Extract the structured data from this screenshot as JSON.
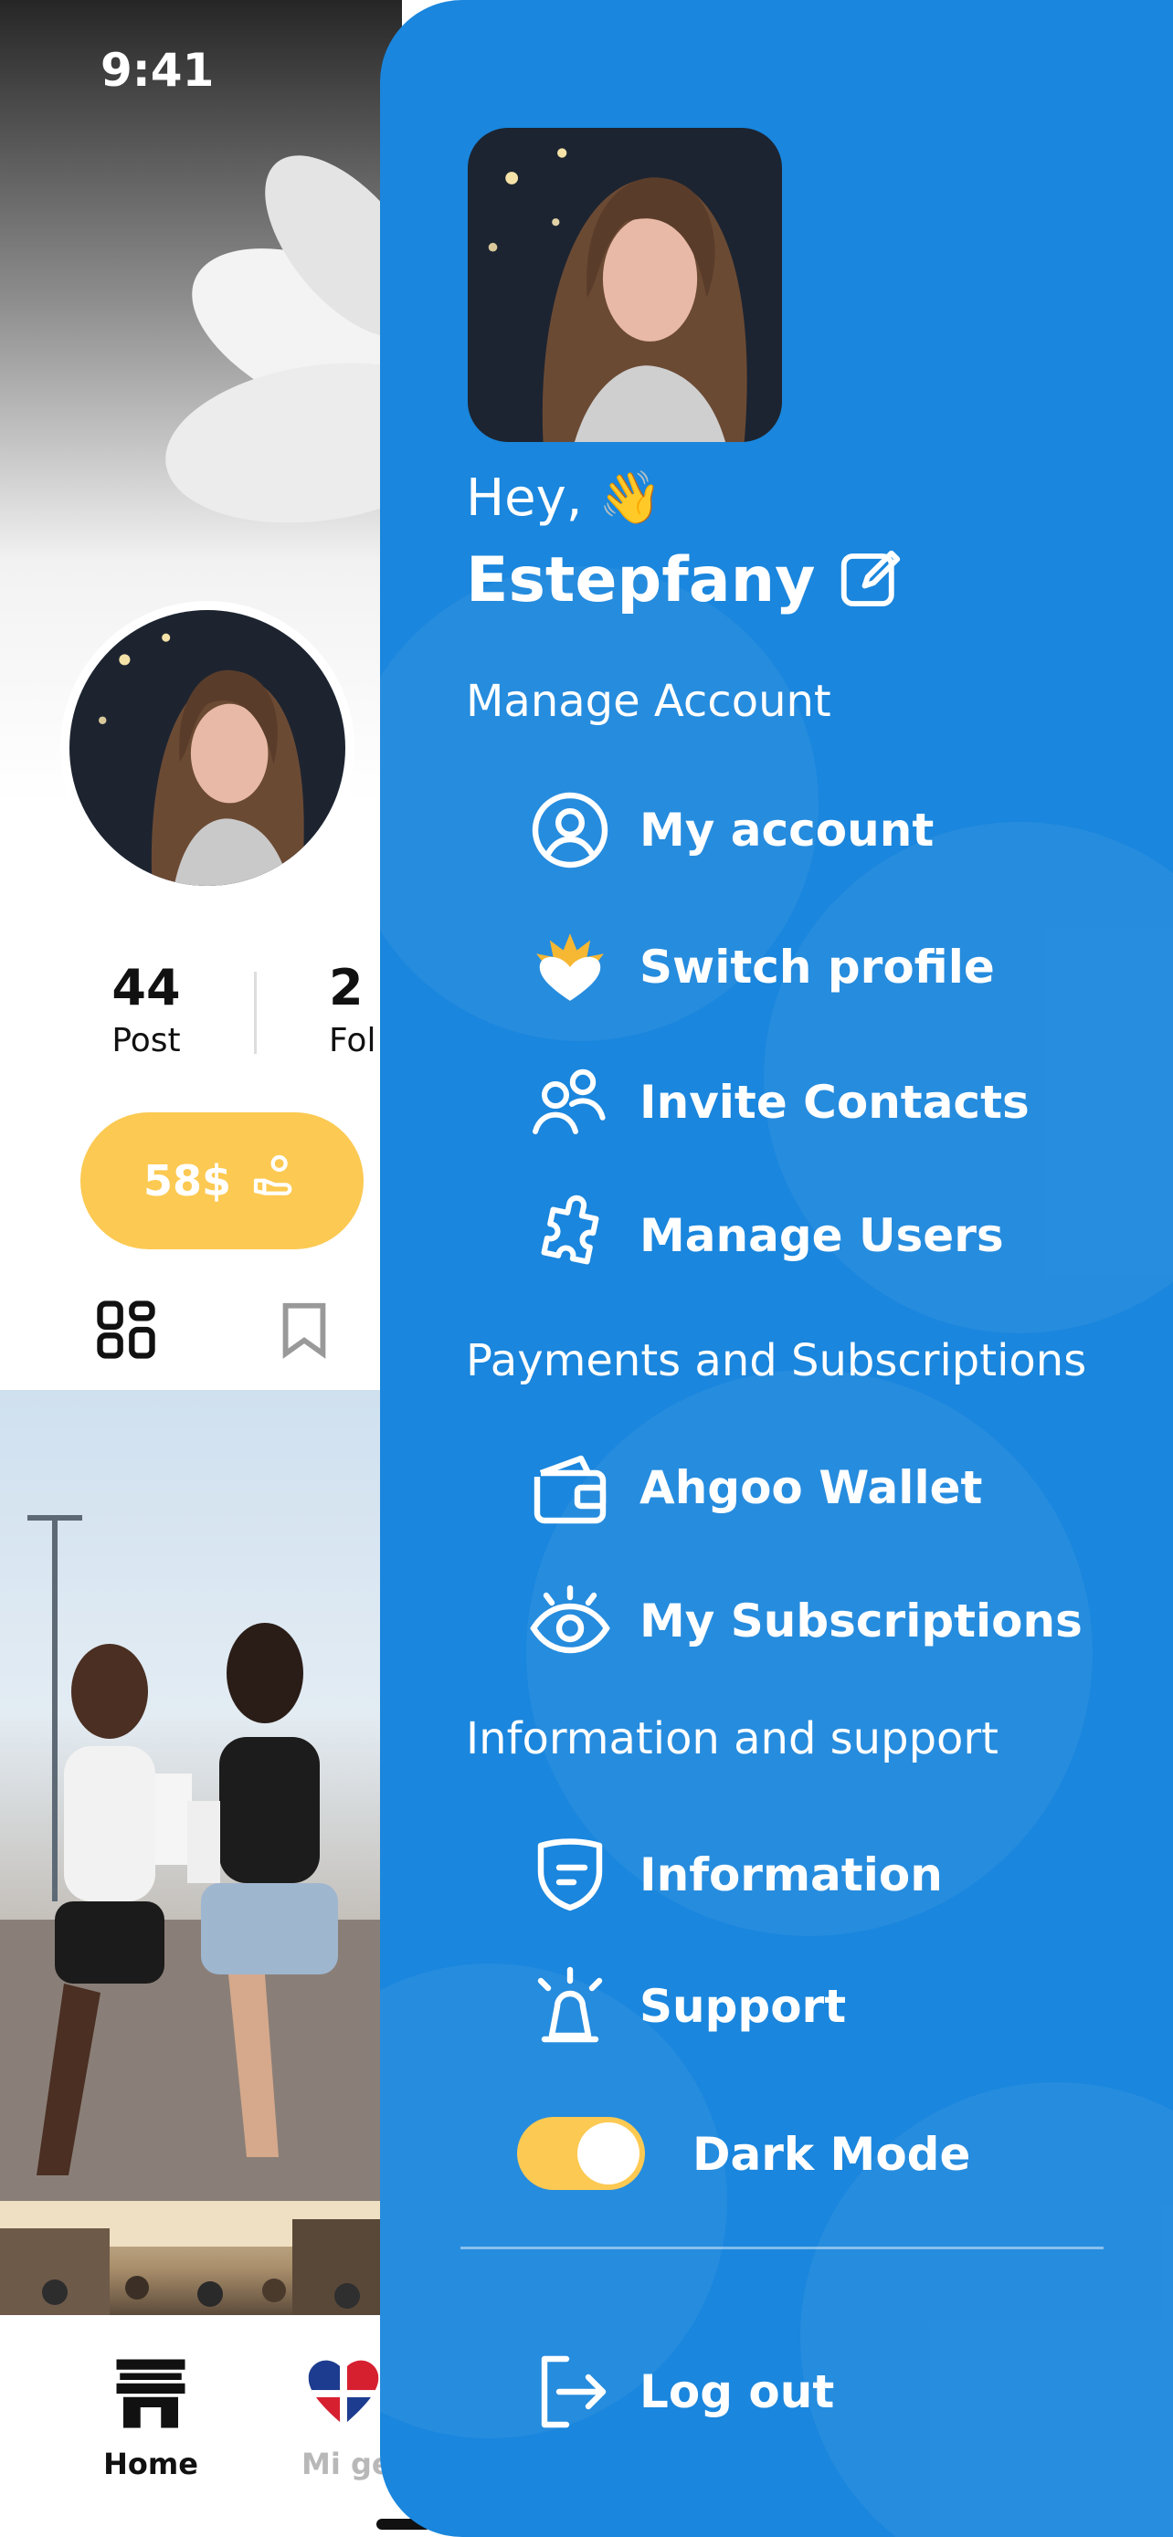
{
  "status_bar": {
    "time": "9:41"
  },
  "profile": {
    "stats": [
      {
        "value": "44",
        "label": "Post"
      },
      {
        "value": "2",
        "label": "Fol"
      }
    ],
    "earnings_label": "58$"
  },
  "bottom_nav": {
    "items": [
      {
        "label": "Home",
        "icon": "home-icon",
        "active": true
      },
      {
        "label": "Mi ge",
        "icon": "heart-flag-icon",
        "active": false
      }
    ]
  },
  "drawer": {
    "greeting": "Hey, 👋",
    "user_name": "Estepfany",
    "sections": [
      {
        "title": "Manage Account",
        "items": [
          {
            "label": "My account",
            "icon": "user-circle-icon"
          },
          {
            "label": "Switch profile",
            "icon": "switch-profile-heart-icon"
          },
          {
            "label": "Invite Contacts",
            "icon": "users-icon"
          },
          {
            "label": "Manage Users",
            "icon": "puzzle-icon"
          }
        ]
      },
      {
        "title": "Payments and Subscriptions",
        "items": [
          {
            "label": "Ahgoo Wallet",
            "icon": "wallet-icon"
          },
          {
            "label": "My Subscriptions",
            "icon": "eye-icon"
          }
        ]
      },
      {
        "title": "Information and support",
        "items": [
          {
            "label": "Information",
            "icon": "shield-info-icon"
          },
          {
            "label": "Support",
            "icon": "siren-icon"
          }
        ]
      }
    ],
    "dark_mode": {
      "label": "Dark Mode",
      "enabled": true
    },
    "logout_label": "Log out"
  },
  "colors": {
    "drawer_bg": "#1a86dd",
    "accent_yellow": "#fcc952",
    "text_on_drawer": "#ffffff"
  }
}
